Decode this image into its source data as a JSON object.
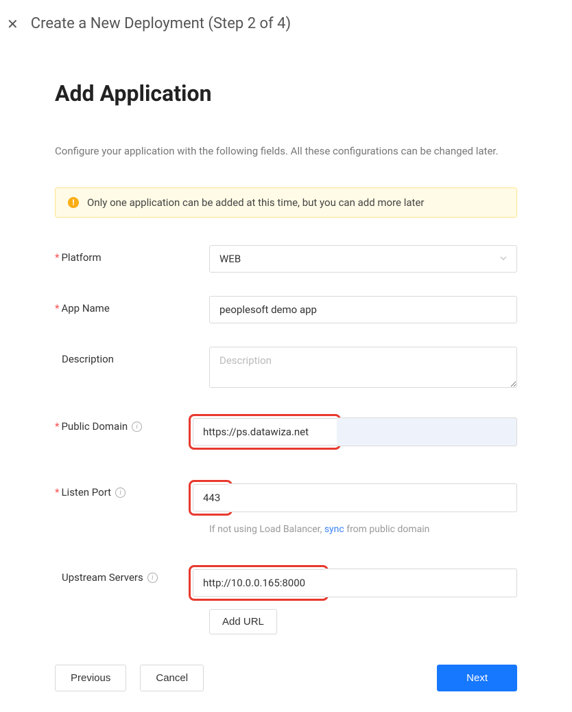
{
  "header": {
    "title": "Create a New Deployment (Step 2 of 4)"
  },
  "page": {
    "heading": "Add Application",
    "subtitle": "Configure your application with the following fields. All these configurations can be changed later."
  },
  "alert": {
    "text": "Only one application can be added at this time, but you can add more later"
  },
  "form": {
    "platform": {
      "label": "Platform",
      "value": "WEB"
    },
    "app_name": {
      "label": "App Name",
      "value": "peoplesoft demo app"
    },
    "description": {
      "label": "Description",
      "placeholder": "Description",
      "value": ""
    },
    "public_domain": {
      "label": "Public Domain",
      "value": "https://ps.datawiza.net"
    },
    "listen_port": {
      "label": "Listen Port",
      "value": "443",
      "hint_prefix": "If not using Load Balancer, ",
      "hint_link": "sync",
      "hint_suffix": " from public domain"
    },
    "upstream_servers": {
      "label": "Upstream Servers",
      "value": "http://10.0.0.165:8000",
      "add_url_label": "Add URL"
    }
  },
  "footer": {
    "previous": "Previous",
    "cancel": "Cancel",
    "next": "Next"
  }
}
